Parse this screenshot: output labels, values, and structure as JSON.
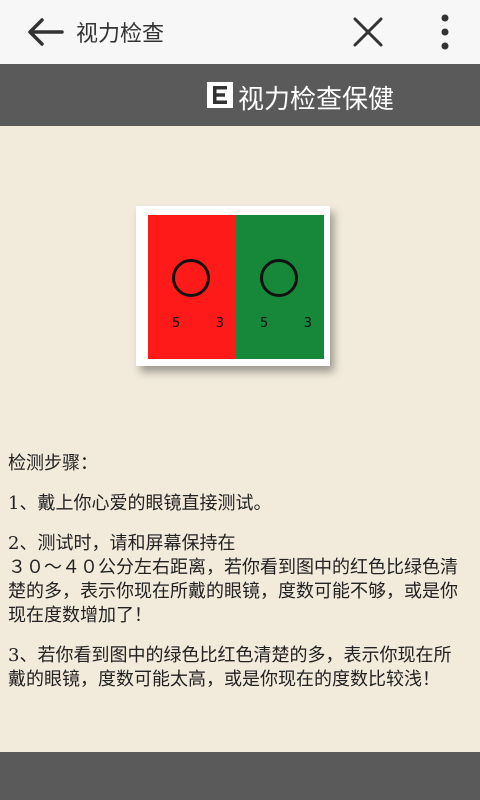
{
  "topbar": {
    "title": "视力检查",
    "back_icon": "back-arrow-icon",
    "close_icon": "close-icon",
    "more_icon": "more-vertical-icon"
  },
  "banner": {
    "logo_letter": "E",
    "title": "视力检查保健",
    "bg_color": "#5a5a5a"
  },
  "test_card": {
    "left": {
      "color": "#ff1a1a",
      "num1": "5",
      "num2": "3"
    },
    "right": {
      "color": "#17873a",
      "num1": "5",
      "num2": "3"
    }
  },
  "content": {
    "heading": "检测步骤：",
    "steps": [
      "1、戴上你心爱的眼镜直接测试。",
      "2、测试时，请和屏幕保持在\n３０～４０公分左右距离，若你看到图中的红色比绿色清楚的多，表示你现在所戴的眼镜，度数可能不够，或是你现在度数增加了！",
      "3、若你看到图中的绿色比红色清楚的多，表示你现在所戴的眼镜，度数可能太高，或是你现在的度数比较浅！"
    ]
  }
}
